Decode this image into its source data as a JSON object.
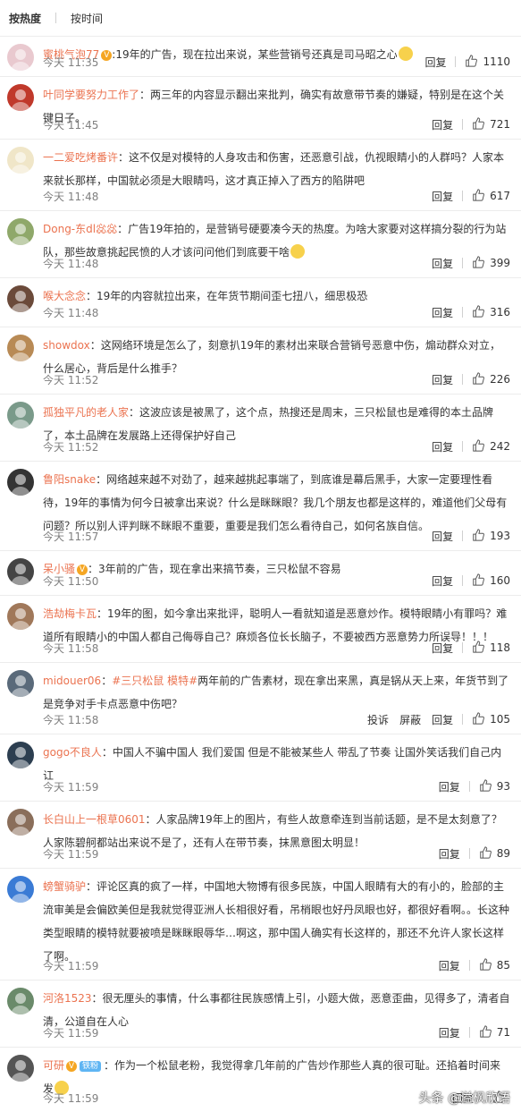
{
  "sort": {
    "hot": "按热度",
    "time": "按时间"
  },
  "actions": {
    "reply": "回复",
    "report": "投诉",
    "block": "屏蔽"
  },
  "watermark": "头条 @溢枫欣语",
  "comments": [
    {
      "user": "蜜桃气泡77",
      "content": ":19年的广告，现在拉出来说，某些营销号还真是司马昭之心",
      "time": "今天 11:35",
      "likes": "1110",
      "avatar_color": "#e9c9cf"
    },
    {
      "user": "叶同学要努力工作了",
      "content": "：两三年的内容显示翻出来批判，确实有故意带节奏的嫌疑，特别是在这个关键日子。",
      "time": "今天 11:45",
      "likes": "721",
      "avatar_color": "#c0392b"
    },
    {
      "user": "一二爱吃烤番许",
      "content": "：这不仅是对模特的人身攻击和伤害，还恶意引战，仇视眼睛小的人群吗？人家本来就长那样，中国就必须是大眼睛吗，这才真正掉入了西方的陷阱吧",
      "time": "今天 11:48",
      "likes": "617",
      "avatar_color": "#f0e6c8"
    },
    {
      "user": "Dong-东dl惢惢",
      "content": "：广告19年拍的，是营销号硬要凑今天的热度。为啥大家要对这样搞分裂的行为站队，那些故意挑起民愤的人才该问问他们到底要干啥",
      "time": "今天 11:48",
      "likes": "399",
      "avatar_color": "#8fa86a"
    },
    {
      "user": "喉大念念",
      "content": "：19年的内容就拉出来，在年货节期间歪七扭八，细思极恐",
      "time": "今天 11:48",
      "likes": "316",
      "avatar_color": "#6b4a3a"
    },
    {
      "user": "showdox",
      "content": "：这网络环境是怎么了，刻意扒19年的素材出来联合营销号恶意中伤，煽动群众对立，什么居心，背后是什么推手？",
      "time": "今天 11:52",
      "likes": "226",
      "avatar_color": "#b88a55"
    },
    {
      "user": "孤独平凡的老人家",
      "content": "：这波应该是被黑了，这个点，热搜还是周末，三只松鼠也是难得的本土品牌了，本土品牌在发展路上还得保护好自己",
      "time": "今天 11:52",
      "likes": "242",
      "avatar_color": "#7a9a8a"
    },
    {
      "user": "鲁阳snake",
      "content": "：网络越来越不对劲了，越来越挑起事端了，到底谁是幕后黑手，大家一定要理性看待，19年的事情为何今日被拿出来说？什么是眯眯眼？我几个朋友也都是这样的，难道他们父母有问题？所以别人评判眯不眯眼不重要，重要是我们怎么看待自己，如何名族自信。",
      "time": "今天 11:57",
      "likes": "193",
      "avatar_color": "#333333"
    },
    {
      "user": "呆小骚",
      "content": "：3年前的广告，现在拿出来搞节奏，三只松鼠不容易",
      "time": "今天 11:50",
      "likes": "160",
      "avatar_color": "#444444"
    },
    {
      "user": "浩劫梅卡瓦",
      "content": "：19年的图，如今拿出来批评，聪明人一看就知道是恶意炒作。模特眼睛小有罪吗？难道所有眼睛小的中国人都自己侮辱自己？麻烦各位长长脑子，不要被西方恶意势力所误导！！！",
      "time": "今天 11:58",
      "likes": "118",
      "avatar_color": "#a0785a"
    },
    {
      "user": "midouer06",
      "topic": "#三只松鼠 模特#",
      "content": "两年前的广告素材，现在拿出来黑，真是锅从天上来，年货节到了是竞争对手卡点恶意中伤吧？",
      "time": "今天 11:58",
      "likes": "105",
      "avatar_color": "#5a6a7a"
    },
    {
      "user": "gogo不良人",
      "content": "：中国人不骗中国人 我们爱国 但是不能被某些人 带乱了节奏 让国外笑话我们自己内讧",
      "time": "今天 11:59",
      "likes": "93",
      "avatar_color": "#2c3e50"
    },
    {
      "user": "长白山上一根草0601",
      "content": "：人家品牌19年上的图片，有些人故意牵连到当前话题，是不是太刻意了？人家陈碧舸都站出来说不是了，还有人在带节奏，抹黑意图太明显！",
      "time": "今天 11:59",
      "likes": "89",
      "avatar_color": "#8a6e5a"
    },
    {
      "user": "螃蟹骑驴",
      "content": "：评论区真的疯了一样，中国地大物博有很多民族，中国人眼睛有大的有小的，脸部的主流审美是会偏欧美但是我就觉得亚洲人长相很好看，吊梢眼也好丹凤眼也好，都很好看啊。。长这种类型眼睛的模特就要被喷是眯眯眼辱华…啊这，那中国人确实有长这样的，那还不允许人家长这样了啊。",
      "time": "今天 11:59",
      "likes": "85",
      "avatar_color": "#3a7bd5"
    },
    {
      "user": "河洛1523",
      "content": "：很无厘头的事情，什么事都往民族感情上引，小题大做，恶意歪曲，见得多了，清者自清，公道自在人心",
      "time": "今天 11:59",
      "likes": "71",
      "avatar_color": "#6a8a6a"
    },
    {
      "user": "可研",
      "tag": "铁粉",
      "content": "：作为一个松鼠老粉，我觉得拿几年前的广告炒作那些人真的很可耻。还掐着时间来发",
      "time": "今天 11:59",
      "likes": "",
      "avatar_color": "#555555"
    }
  ]
}
